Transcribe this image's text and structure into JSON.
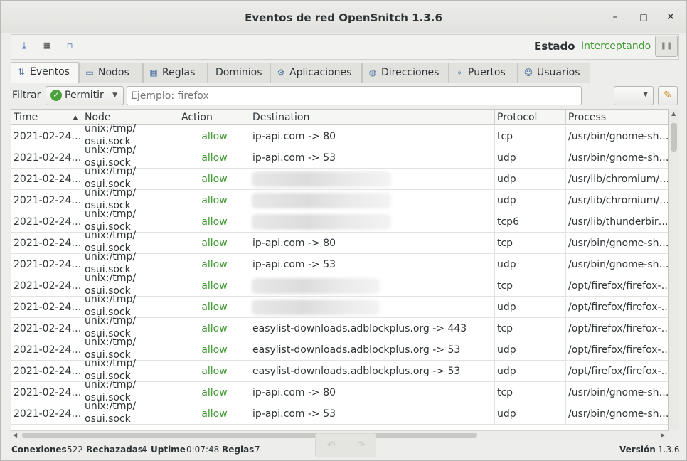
{
  "window": {
    "title": "Eventos de red OpenSnitch 1.3.6",
    "controls": {
      "minimize": "–",
      "maximize": "□",
      "close": "✕"
    }
  },
  "toolbar": {
    "icons": [
      "save-icon",
      "rules-icon",
      "new-rule-icon"
    ],
    "estado_label": "Estado",
    "estado_value": "Interceptando",
    "pause_icon": "pause-icon"
  },
  "tabs": [
    {
      "label": "Eventos",
      "icon": "events-icon",
      "active": true
    },
    {
      "label": "Nodos",
      "icon": "nodes-icon"
    },
    {
      "label": "Reglas",
      "icon": "rules-icon"
    },
    {
      "label": "Dominios",
      "icon": ""
    },
    {
      "label": "Aplicaciones",
      "icon": "apps-icon"
    },
    {
      "label": "Direcciones",
      "icon": "globe-icon"
    },
    {
      "label": "Puertos",
      "icon": "ports-icon"
    },
    {
      "label": "Usuarios",
      "icon": "users-icon"
    }
  ],
  "filter": {
    "label": "Filtrar",
    "action_selected": "Permitir",
    "search_placeholder": "Ejemplo: firefox",
    "clear_icon": "broom-icon"
  },
  "table": {
    "columns": [
      "Time",
      "Node",
      "Action",
      "Destination",
      "Protocol",
      "Process"
    ],
    "rows": [
      {
        "time": "2021-02-24…",
        "node1": "unix:/tmp/",
        "node2": "osui.sock",
        "action": "allow",
        "dest": "ip-api.com  ->  80",
        "proto": "tcp",
        "proc": "/usr/bin/gnome-sh…"
      },
      {
        "time": "2021-02-24…",
        "node1": "unix:/tmp/",
        "node2": "osui.sock",
        "action": "allow",
        "dest": "ip-api.com  ->  53",
        "proto": "udp",
        "proc": "/usr/bin/gnome-sh…"
      },
      {
        "time": "2021-02-24…",
        "node1": "unix:/tmp/",
        "node2": "osui.sock",
        "action": "allow",
        "dest": "",
        "proto": "udp",
        "proc": "/usr/lib/chromium/…"
      },
      {
        "time": "2021-02-24…",
        "node1": "unix:/tmp/",
        "node2": "osui.sock",
        "action": "allow",
        "dest": "",
        "proto": "udp",
        "proc": "/usr/lib/chromium/…"
      },
      {
        "time": "2021-02-24…",
        "node1": "unix:/tmp/",
        "node2": "osui.sock",
        "action": "allow",
        "dest": "",
        "proto": "tcp6",
        "proc": "/usr/lib/thunderbir…"
      },
      {
        "time": "2021-02-24…",
        "node1": "unix:/tmp/",
        "node2": "osui.sock",
        "action": "allow",
        "dest": "ip-api.com  ->  80",
        "proto": "tcp",
        "proc": "/usr/bin/gnome-sh…"
      },
      {
        "time": "2021-02-24…",
        "node1": "unix:/tmp/",
        "node2": "osui.sock",
        "action": "allow",
        "dest": "ip-api.com  ->  53",
        "proto": "udp",
        "proc": "/usr/bin/gnome-sh…"
      },
      {
        "time": "2021-02-24…",
        "node1": "unix:/tmp/",
        "node2": "osui.sock",
        "action": "allow",
        "dest": "",
        "proto": "tcp",
        "proc": "/opt/firefox/firefox-…"
      },
      {
        "time": "2021-02-24…",
        "node1": "unix:/tmp/",
        "node2": "osui.sock",
        "action": "allow",
        "dest": "",
        "proto": "udp",
        "proc": "/opt/firefox/firefox-…"
      },
      {
        "time": "2021-02-24…",
        "node1": "unix:/tmp/",
        "node2": "osui.sock",
        "action": "allow",
        "dest": "easylist-downloads.adblockplus.org  ->  443",
        "proto": "tcp",
        "proc": "/opt/firefox/firefox-…"
      },
      {
        "time": "2021-02-24…",
        "node1": "unix:/tmp/",
        "node2": "osui.sock",
        "action": "allow",
        "dest": "easylist-downloads.adblockplus.org  ->  53",
        "proto": "udp",
        "proc": "/opt/firefox/firefox-…"
      },
      {
        "time": "2021-02-24…",
        "node1": "unix:/tmp/",
        "node2": "osui.sock",
        "action": "allow",
        "dest": "easylist-downloads.adblockplus.org  ->  53",
        "proto": "udp",
        "proc": "/opt/firefox/firefox-…"
      },
      {
        "time": "2021-02-24…",
        "node1": "unix:/tmp/",
        "node2": "osui.sock",
        "action": "allow",
        "dest": "ip-api.com  ->  80",
        "proto": "tcp",
        "proc": "/usr/bin/gnome-sh…"
      },
      {
        "time": "2021-02-24…",
        "node1": "unix:/tmp/",
        "node2": "osui.sock",
        "action": "allow",
        "dest": "ip-api.com  ->  53",
        "proto": "udp",
        "proc": "/usr/bin/gnome-sh…"
      }
    ]
  },
  "status": {
    "conexiones_label": "Conexiones",
    "conexiones": "522",
    "rechazadas_label": "Rechazadas",
    "rechazadas": "4",
    "uptime_label": "Uptime",
    "uptime": "0:07:48",
    "reglas_label": "Reglas",
    "reglas": "7",
    "version_label": "Versión",
    "version": "1.3.6"
  },
  "nav": {
    "prev": "↶",
    "next": "↷"
  }
}
